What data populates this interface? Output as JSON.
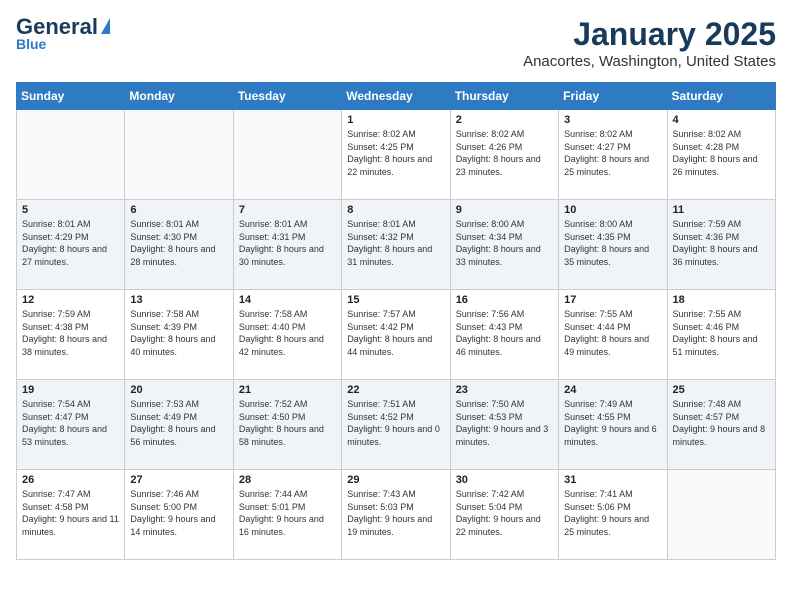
{
  "header": {
    "logo_general": "General",
    "logo_blue": "Blue",
    "month": "January 2025",
    "location": "Anacortes, Washington, United States"
  },
  "weekdays": [
    "Sunday",
    "Monday",
    "Tuesday",
    "Wednesday",
    "Thursday",
    "Friday",
    "Saturday"
  ],
  "weeks": [
    [
      {
        "day": "",
        "content": ""
      },
      {
        "day": "",
        "content": ""
      },
      {
        "day": "",
        "content": ""
      },
      {
        "day": "1",
        "content": "Sunrise: 8:02 AM\nSunset: 4:25 PM\nDaylight: 8 hours\nand 22 minutes."
      },
      {
        "day": "2",
        "content": "Sunrise: 8:02 AM\nSunset: 4:26 PM\nDaylight: 8 hours\nand 23 minutes."
      },
      {
        "day": "3",
        "content": "Sunrise: 8:02 AM\nSunset: 4:27 PM\nDaylight: 8 hours\nand 25 minutes."
      },
      {
        "day": "4",
        "content": "Sunrise: 8:02 AM\nSunset: 4:28 PM\nDaylight: 8 hours\nand 26 minutes."
      }
    ],
    [
      {
        "day": "5",
        "content": "Sunrise: 8:01 AM\nSunset: 4:29 PM\nDaylight: 8 hours\nand 27 minutes."
      },
      {
        "day": "6",
        "content": "Sunrise: 8:01 AM\nSunset: 4:30 PM\nDaylight: 8 hours\nand 28 minutes."
      },
      {
        "day": "7",
        "content": "Sunrise: 8:01 AM\nSunset: 4:31 PM\nDaylight: 8 hours\nand 30 minutes."
      },
      {
        "day": "8",
        "content": "Sunrise: 8:01 AM\nSunset: 4:32 PM\nDaylight: 8 hours\nand 31 minutes."
      },
      {
        "day": "9",
        "content": "Sunrise: 8:00 AM\nSunset: 4:34 PM\nDaylight: 8 hours\nand 33 minutes."
      },
      {
        "day": "10",
        "content": "Sunrise: 8:00 AM\nSunset: 4:35 PM\nDaylight: 8 hours\nand 35 minutes."
      },
      {
        "day": "11",
        "content": "Sunrise: 7:59 AM\nSunset: 4:36 PM\nDaylight: 8 hours\nand 36 minutes."
      }
    ],
    [
      {
        "day": "12",
        "content": "Sunrise: 7:59 AM\nSunset: 4:38 PM\nDaylight: 8 hours\nand 38 minutes."
      },
      {
        "day": "13",
        "content": "Sunrise: 7:58 AM\nSunset: 4:39 PM\nDaylight: 8 hours\nand 40 minutes."
      },
      {
        "day": "14",
        "content": "Sunrise: 7:58 AM\nSunset: 4:40 PM\nDaylight: 8 hours\nand 42 minutes."
      },
      {
        "day": "15",
        "content": "Sunrise: 7:57 AM\nSunset: 4:42 PM\nDaylight: 8 hours\nand 44 minutes."
      },
      {
        "day": "16",
        "content": "Sunrise: 7:56 AM\nSunset: 4:43 PM\nDaylight: 8 hours\nand 46 minutes."
      },
      {
        "day": "17",
        "content": "Sunrise: 7:55 AM\nSunset: 4:44 PM\nDaylight: 8 hours\nand 49 minutes."
      },
      {
        "day": "18",
        "content": "Sunrise: 7:55 AM\nSunset: 4:46 PM\nDaylight: 8 hours\nand 51 minutes."
      }
    ],
    [
      {
        "day": "19",
        "content": "Sunrise: 7:54 AM\nSunset: 4:47 PM\nDaylight: 8 hours\nand 53 minutes."
      },
      {
        "day": "20",
        "content": "Sunrise: 7:53 AM\nSunset: 4:49 PM\nDaylight: 8 hours\nand 56 minutes."
      },
      {
        "day": "21",
        "content": "Sunrise: 7:52 AM\nSunset: 4:50 PM\nDaylight: 8 hours\nand 58 minutes."
      },
      {
        "day": "22",
        "content": "Sunrise: 7:51 AM\nSunset: 4:52 PM\nDaylight: 9 hours\nand 0 minutes."
      },
      {
        "day": "23",
        "content": "Sunrise: 7:50 AM\nSunset: 4:53 PM\nDaylight: 9 hours\nand 3 minutes."
      },
      {
        "day": "24",
        "content": "Sunrise: 7:49 AM\nSunset: 4:55 PM\nDaylight: 9 hours\nand 6 minutes."
      },
      {
        "day": "25",
        "content": "Sunrise: 7:48 AM\nSunset: 4:57 PM\nDaylight: 9 hours\nand 8 minutes."
      }
    ],
    [
      {
        "day": "26",
        "content": "Sunrise: 7:47 AM\nSunset: 4:58 PM\nDaylight: 9 hours\nand 11 minutes."
      },
      {
        "day": "27",
        "content": "Sunrise: 7:46 AM\nSunset: 5:00 PM\nDaylight: 9 hours\nand 14 minutes."
      },
      {
        "day": "28",
        "content": "Sunrise: 7:44 AM\nSunset: 5:01 PM\nDaylight: 9 hours\nand 16 minutes."
      },
      {
        "day": "29",
        "content": "Sunrise: 7:43 AM\nSunset: 5:03 PM\nDaylight: 9 hours\nand 19 minutes."
      },
      {
        "day": "30",
        "content": "Sunrise: 7:42 AM\nSunset: 5:04 PM\nDaylight: 9 hours\nand 22 minutes."
      },
      {
        "day": "31",
        "content": "Sunrise: 7:41 AM\nSunset: 5:06 PM\nDaylight: 9 hours\nand 25 minutes."
      },
      {
        "day": "",
        "content": ""
      }
    ]
  ]
}
